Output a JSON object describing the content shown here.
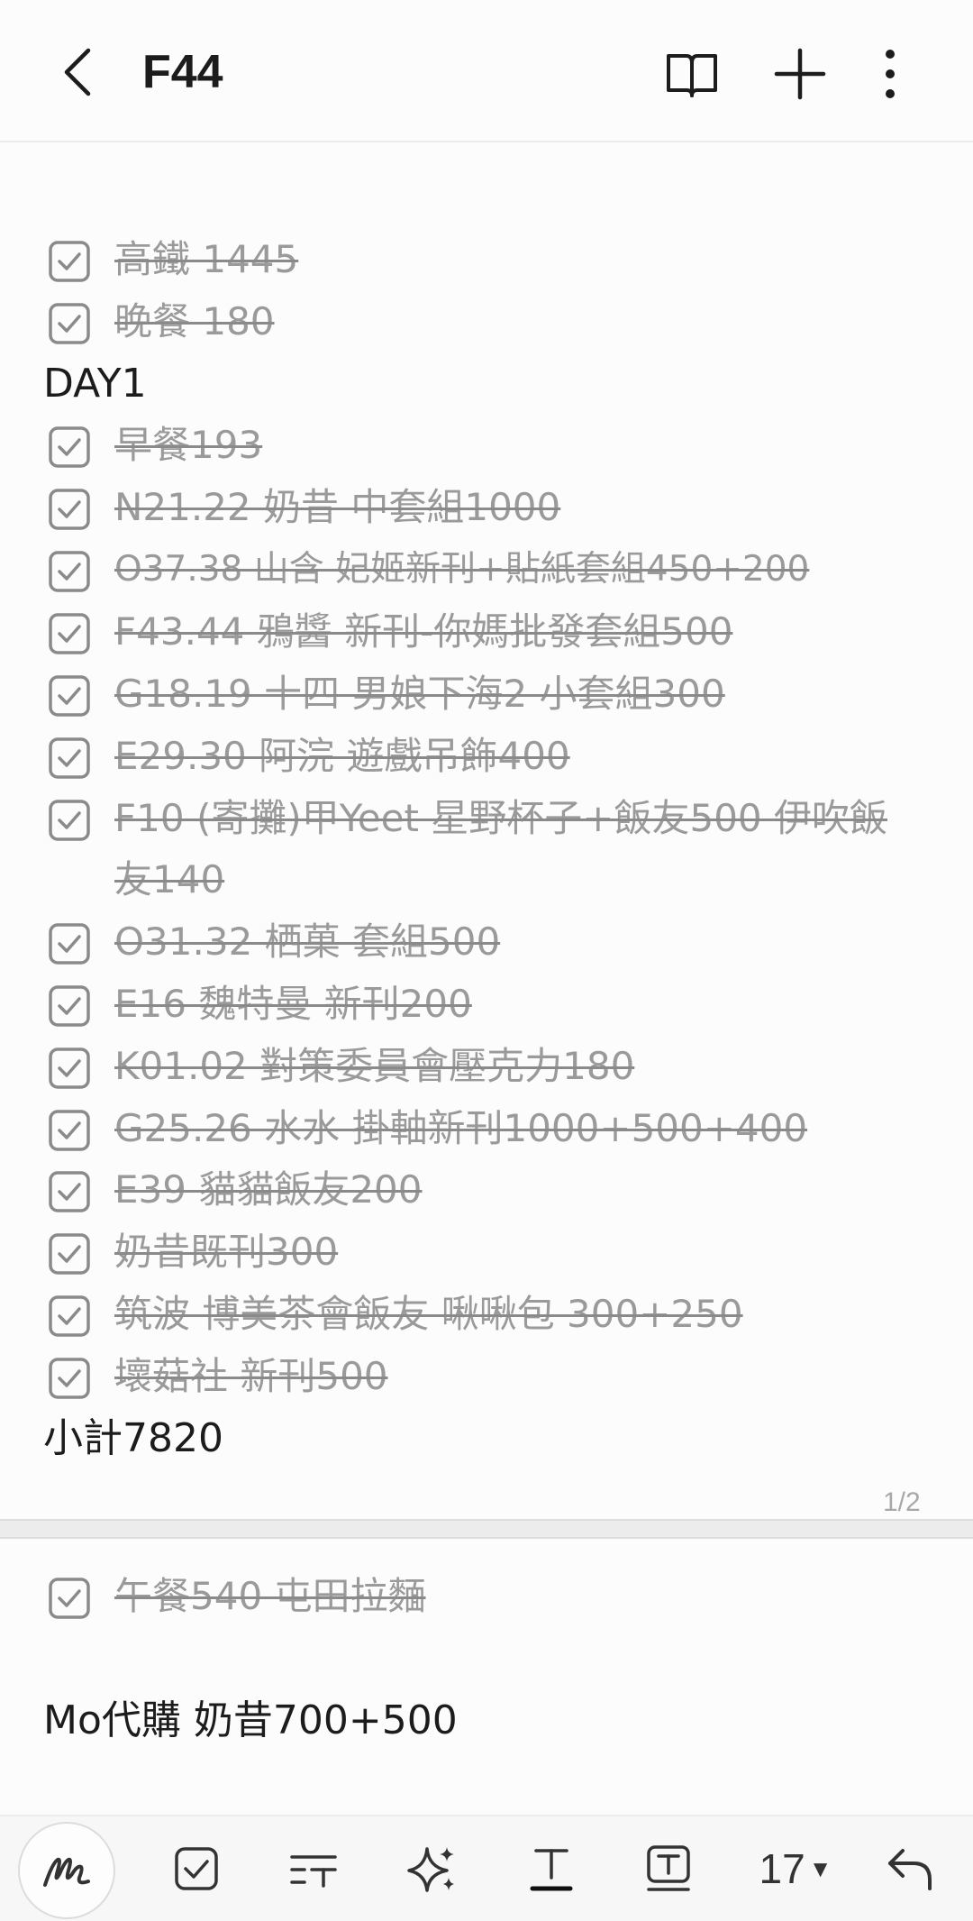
{
  "header": {
    "title": "F44"
  },
  "note": {
    "page1": [
      {
        "type": "check",
        "checked": true,
        "text": "高鐵 1445"
      },
      {
        "type": "check",
        "checked": true,
        "text": "晚餐 180"
      },
      {
        "type": "text",
        "text": "DAY1"
      },
      {
        "type": "check",
        "checked": true,
        "text": "早餐193"
      },
      {
        "type": "check",
        "checked": true,
        "text": "N21.22 奶昔 中套組1000"
      },
      {
        "type": "check",
        "checked": true,
        "text": "O37.38 山含 妃姬新刊+貼紙套組450+200"
      },
      {
        "type": "check",
        "checked": true,
        "text": "F43.44 鴉醬 新刊-你媽批發套組500"
      },
      {
        "type": "check",
        "checked": true,
        "text": "G18.19 十四 男娘下海2 小套組300"
      },
      {
        "type": "check",
        "checked": true,
        "text": "E29.30 阿浣 遊戲吊飾400"
      },
      {
        "type": "check",
        "checked": true,
        "text": "F10 (寄攤)甲Yeet 星野杯子+飯友500 伊吹飯友140"
      },
      {
        "type": "check",
        "checked": true,
        "text": "O31.32 栖菓 套組500"
      },
      {
        "type": "check",
        "checked": true,
        "text": "E16 魏特曼 新刊200"
      },
      {
        "type": "check",
        "checked": true,
        "text": "K01.02 對策委員會壓克力180"
      },
      {
        "type": "check",
        "checked": true,
        "text": "G25.26 水水 掛軸新刊1000+500+400"
      },
      {
        "type": "check",
        "checked": true,
        "text": "E39 貓貓飯友200"
      },
      {
        "type": "check",
        "checked": true,
        "text": "奶昔既刊300"
      },
      {
        "type": "check",
        "checked": true,
        "text": "筑波 博美茶會飯友 啾啾包 300+250"
      },
      {
        "type": "check",
        "checked": true,
        "text": "壞菇社 新刊500"
      },
      {
        "type": "text",
        "text": "小計7820"
      }
    ],
    "page_indicator": "1/2",
    "page2": [
      {
        "type": "check",
        "checked": true,
        "text": "午餐540 屯田拉麵"
      },
      {
        "type": "text",
        "text": "Mo代購 奶昔700+500"
      }
    ]
  },
  "toolbar": {
    "font_size": "17",
    "items": [
      "handwriting-icon",
      "checkbox-icon",
      "text-style-icon",
      "ai-sparkle-icon",
      "text-format-icon",
      "text-box-icon",
      "font-size",
      "undo-icon"
    ]
  },
  "colors": {
    "background": "#fcfcfc",
    "done_text": "#9a9a9a",
    "text": "#1c1c1c",
    "checkbox": "#8a8a8a"
  }
}
